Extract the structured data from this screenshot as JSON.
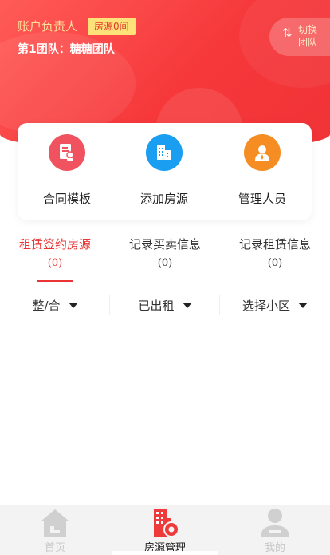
{
  "header": {
    "role_label": "账户负责人",
    "badge": "房源0间",
    "team": "第1团队：糖糖团队",
    "switch_label": "切换团队",
    "switch_icon": "⇅"
  },
  "quick_actions": [
    {
      "label": "合同模板",
      "icon": "contract-icon",
      "color": "#f0535f"
    },
    {
      "label": "添加房源",
      "icon": "building-icon",
      "color": "#1a9ef2"
    },
    {
      "label": "管理人员",
      "icon": "person-icon",
      "color": "#f58d23"
    }
  ],
  "tabs": [
    {
      "title": "租赁签约房源",
      "count": "(0)"
    },
    {
      "title": "记录买卖信息",
      "count": "(0)"
    },
    {
      "title": "记录租赁信息",
      "count": "(0)"
    }
  ],
  "filters": [
    {
      "label": "整/合"
    },
    {
      "label": "已出租"
    },
    {
      "label": "选择小区"
    }
  ],
  "bottom_nav": [
    {
      "label": "首页",
      "icon": "home-icon"
    },
    {
      "label": "房源管理",
      "icon": "property-management-icon"
    },
    {
      "label": "我的",
      "icon": "user-icon"
    }
  ],
  "colors": {
    "brand_red": "#e93434",
    "badge_yellow": "#ffe17a"
  }
}
